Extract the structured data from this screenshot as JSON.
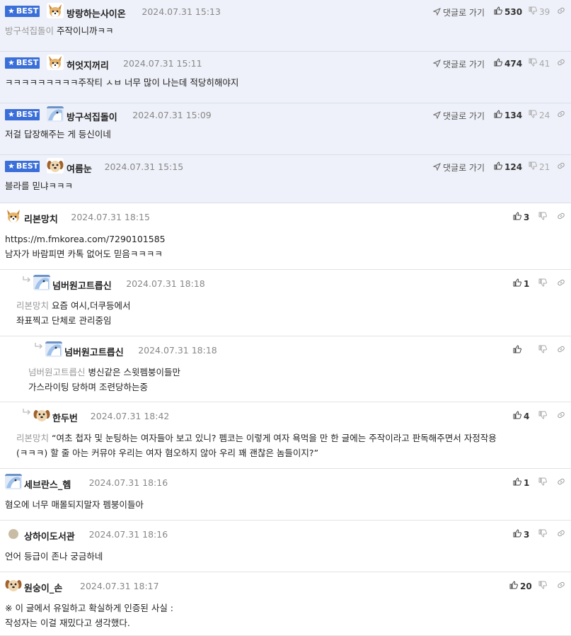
{
  "ui": {
    "best_label": "BEST",
    "goto_label": "댓글로 가기"
  },
  "best_comments": [
    {
      "nick": "방랑하는사이온",
      "date": "2024.07.31 15:13",
      "likes": "530",
      "dislikes": "39",
      "mention": "방구석집돌이",
      "lines": [
        "주작이니까ㅋㅋ"
      ],
      "avatar": "fox"
    },
    {
      "nick": "허엇지꺼리",
      "date": "2024.07.31 15:11",
      "likes": "474",
      "dislikes": "41",
      "mention": "",
      "lines": [
        "ㅋㅋㅋㅋㅋㅋㅋㅋㅋ주작티 ㅅㅂ 너무 많이 나는데 적당히해야지"
      ],
      "avatar": "fox"
    },
    {
      "nick": "방구석집돌이",
      "date": "2024.07.31 15:09",
      "likes": "134",
      "dislikes": "24",
      "mention": "",
      "lines": [
        "저걸 답장해주는 게 등신이네"
      ],
      "avatar": "blue-bird"
    },
    {
      "nick": "여름눈",
      "date": "2024.07.31 15:15",
      "likes": "124",
      "dislikes": "21",
      "mention": "",
      "lines": [
        "블라를 믿냐ㅋㅋㅋ"
      ],
      "avatar": "puppy"
    }
  ],
  "comments": [
    {
      "nick": "리본망치",
      "date": "2024.07.31 18:15",
      "likes": "3",
      "mention": "",
      "lines": [
        "https://m.fmkorea.com/7290101585",
        "남자가 바람피면 카톡 없어도 믿음ㅋㅋㅋㅋ"
      ],
      "avatar": "fox"
    },
    {
      "nick": "넘버원고트릅신",
      "date": "2024.07.31 18:18",
      "likes": "1",
      "mention": "리본망치",
      "lines": [
        "요즘 여시,더쿠등에서",
        "좌표찍고 단체로 관리중임"
      ],
      "avatar": "blue-bird"
    },
    {
      "nick": "넘버원고트릅신",
      "date": "2024.07.31 18:18",
      "likes": "",
      "mention": "넘버원고트릅신",
      "lines": [
        "병신같은 스윗펨붕이들만",
        "가스라이팅 당하며 조련당하는중"
      ],
      "avatar": "blue-bird"
    },
    {
      "nick": "한두번",
      "date": "2024.07.31 18:42",
      "likes": "4",
      "mention": "리본망치",
      "lines": [
        "“여초 첩자 및 눈팅하는 여자들아 보고 있니? 펨코는 이렇게 여자 욕먹을 만 한 글에는 주작이라고 판독해주면서 자정작용",
        "(ㅋㅋㅋ) 할 줄 아는 커뮤야 우리는 여자 혐오하지 않아 우리 꽤 괜찮은 놈들이지?”"
      ],
      "avatar": "puppy"
    },
    {
      "nick": "세브란스_헴",
      "date": "2024.07.31 18:16",
      "likes": "1",
      "mention": "",
      "lines": [
        "혐오에 너무 매몰되지말자 펨붕이들아"
      ],
      "avatar": "blue-bird"
    },
    {
      "nick": "상하이도서관",
      "date": "2024.07.31 18:16",
      "likes": "3",
      "mention": "",
      "lines": [
        "언어 등급이 존나 궁금하네"
      ],
      "avatar": "dot"
    },
    {
      "nick": "원숭이_손",
      "date": "2024.07.31 18:17",
      "likes": "20",
      "mention": "",
      "lines": [
        "※ 이 글에서 유일하고 확실하게 인증된 사실 :",
        "작성자는 이걸 재밌다고 생각했다."
      ],
      "avatar": "puppy"
    }
  ],
  "icons": {
    "best": "star-icon",
    "goto": "send-arrow-icon",
    "like": "thumbs-up-icon",
    "dislike": "thumbs-down-icon",
    "menu": "link-icon",
    "reply": "reply-arrow-icon"
  },
  "colors": {
    "best_badge": "#3a6ed8",
    "best_background": "#eef1f9",
    "date": "#888888",
    "mention": "#999999"
  }
}
